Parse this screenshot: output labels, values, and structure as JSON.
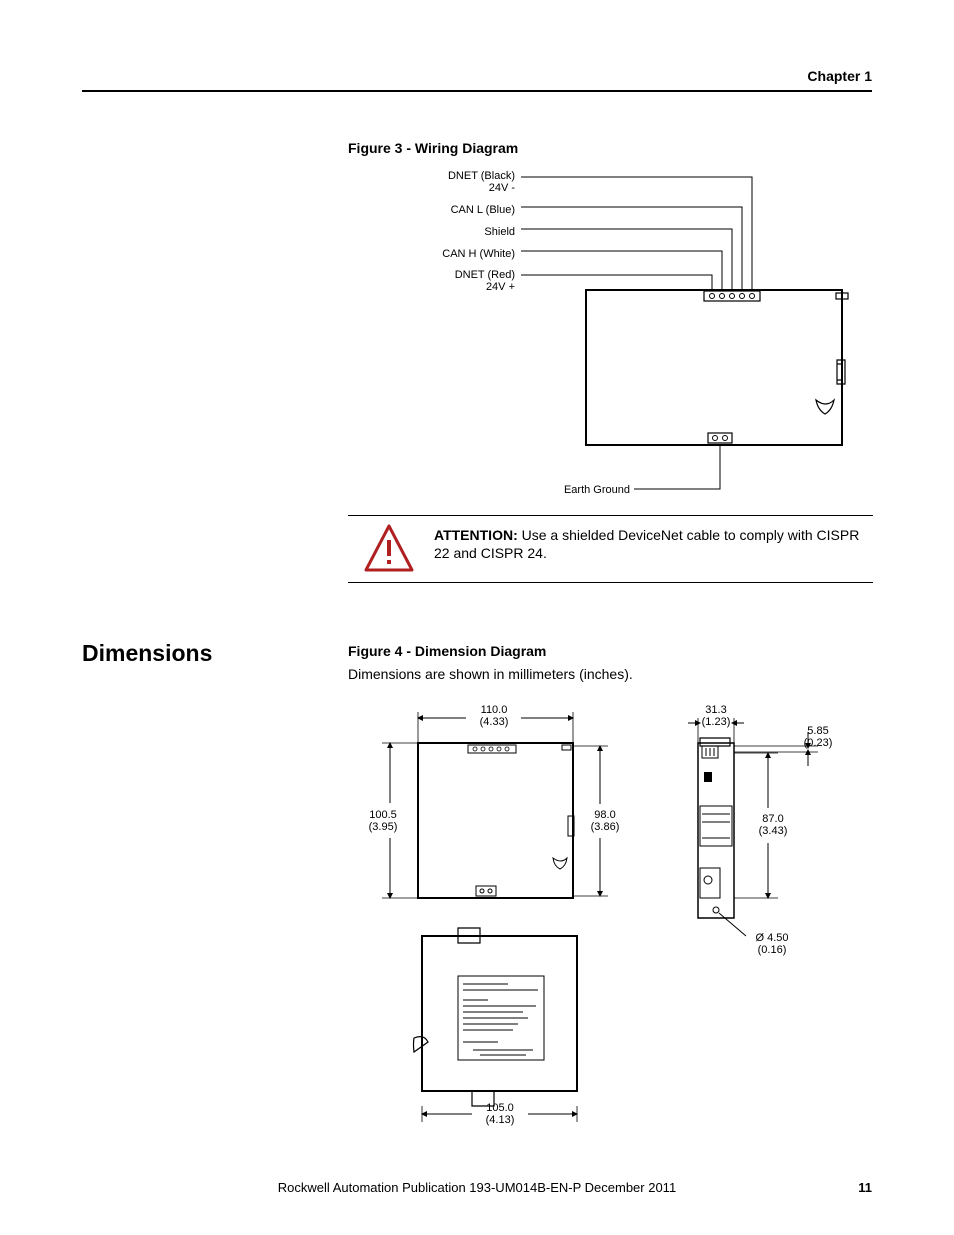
{
  "header": {
    "chapter": "Chapter 1"
  },
  "figure3": {
    "caption": "Figure 3 - Wiring Diagram",
    "wires": {
      "dnet_black": {
        "line1": "DNET (Black)",
        "line2": "24V -"
      },
      "can_l": "CAN L (Blue)",
      "shield": "Shield",
      "can_h": "CAN H (White)",
      "dnet_red": {
        "line1": "DNET (Red)",
        "line2": "24V +"
      },
      "earth": "Earth Ground"
    }
  },
  "attention": {
    "label": "ATTENTION:",
    "text": "Use a shielded DeviceNet cable to comply with CISPR 22 and CISPR 24."
  },
  "section_title": "Dimensions",
  "figure4": {
    "caption": "Figure 4 - Dimension Diagram",
    "note": "Dimensions are shown in millimeters (inches).",
    "dims": {
      "width_top": {
        "mm": "110.0",
        "in": "(4.33)"
      },
      "height_left": {
        "mm": "100.5",
        "in": "(3.95)"
      },
      "height_inner": {
        "mm": "98.0",
        "in": "(3.86)"
      },
      "width_bottom": {
        "mm": "105.0",
        "in": "(4.13)"
      },
      "side_width": {
        "mm": "31.3",
        "in": "(1.23)"
      },
      "side_tab": {
        "mm": "5.85",
        "in": "(0.23)"
      },
      "side_body": {
        "mm": "87.0",
        "in": "(3.43)"
      },
      "hole": {
        "mm": "Ø 4.50",
        "in": "(0.16)"
      }
    }
  },
  "footer": {
    "publication": "Rockwell Automation Publication  193-UM014B-EN-P December 2011",
    "page_number": "11"
  }
}
